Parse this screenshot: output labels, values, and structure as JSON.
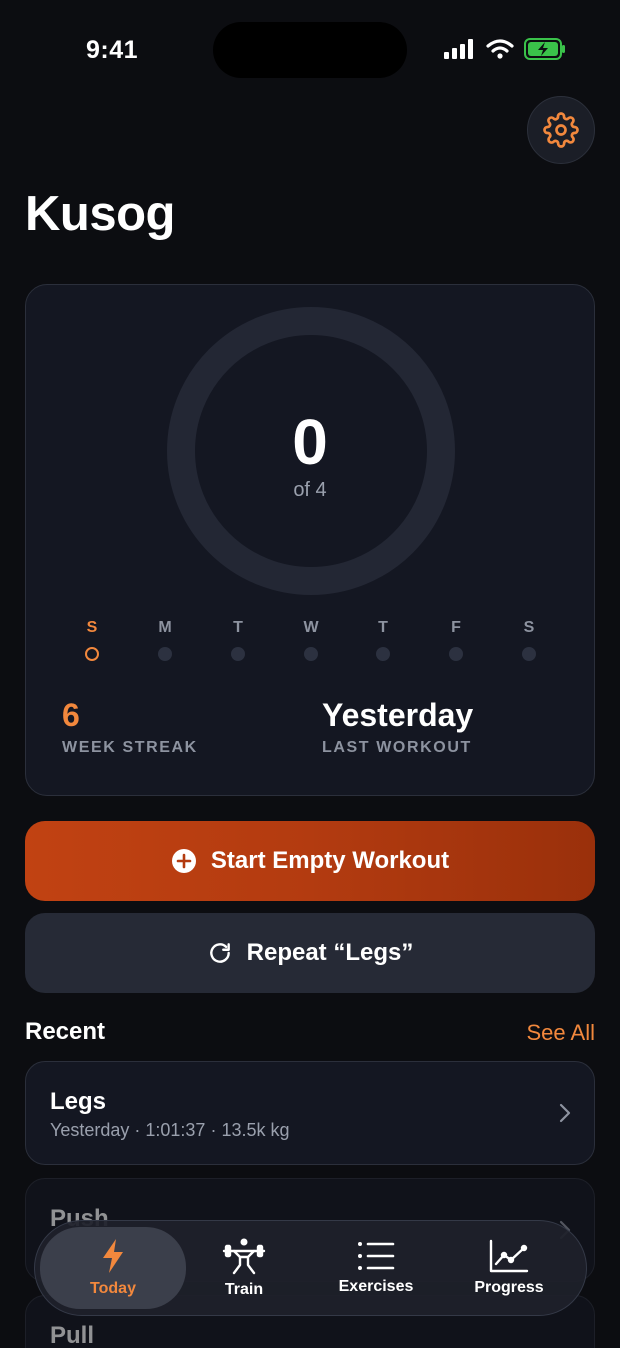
{
  "status_bar": {
    "time": "9:41"
  },
  "header": {
    "title": "Kusog",
    "settings_icon": "gear-icon"
  },
  "summary": {
    "count": "0",
    "goal_text": "of 4",
    "progress_fraction": 0,
    "days": [
      {
        "letter": "S",
        "state": "today"
      },
      {
        "letter": "M",
        "state": "empty"
      },
      {
        "letter": "T",
        "state": "empty"
      },
      {
        "letter": "W",
        "state": "empty"
      },
      {
        "letter": "T",
        "state": "empty"
      },
      {
        "letter": "F",
        "state": "empty"
      },
      {
        "letter": "S",
        "state": "empty"
      }
    ],
    "streak_value": "6",
    "streak_label": "WEEK STREAK",
    "last_workout_value": "Yesterday",
    "last_workout_label": "LAST WORKOUT"
  },
  "actions": {
    "start_label": "Start Empty Workout",
    "repeat_label": "Repeat “Legs”"
  },
  "recent": {
    "title": "Recent",
    "see_all": "See All",
    "items": [
      {
        "name": "Legs",
        "meta": "Yesterday · 1:01:37 · 13.5k kg"
      },
      {
        "name": "Push",
        "meta": ""
      },
      {
        "name": "Pull",
        "meta": ""
      }
    ]
  },
  "tabs": [
    {
      "label": "Today",
      "icon": "bolt-icon",
      "active": true
    },
    {
      "label": "Train",
      "icon": "weightlifter-icon",
      "active": false
    },
    {
      "label": "Exercises",
      "icon": "list-icon",
      "active": false
    },
    {
      "label": "Progress",
      "icon": "chart-icon",
      "active": false
    }
  ],
  "colors": {
    "accent": "#f2883d",
    "start_button": "#b33b10",
    "background": "#0c0d11"
  }
}
